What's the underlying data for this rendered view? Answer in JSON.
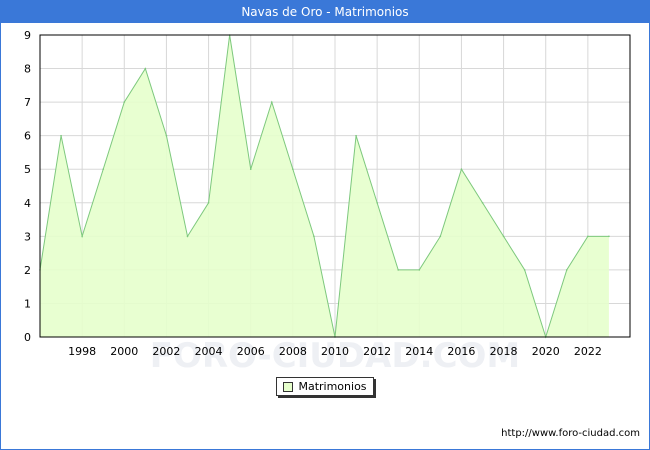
{
  "title": "Navas de Oro - Matrimonios",
  "source": "http://www.foro-ciudad.com",
  "watermark": "FORO-CIUDAD.COM",
  "chart_data": {
    "type": "area",
    "title": "Navas de Oro - Matrimonios",
    "xlabel": "",
    "ylabel": "",
    "x": [
      1996,
      1997,
      1998,
      1999,
      2000,
      2001,
      2002,
      2003,
      2004,
      2005,
      2006,
      2007,
      2008,
      2009,
      2010,
      2011,
      2012,
      2013,
      2014,
      2015,
      2016,
      2017,
      2018,
      2019,
      2020,
      2021,
      2022,
      2023
    ],
    "series": [
      {
        "name": "Matrimonios",
        "values": [
          2,
          6,
          3,
          5,
          7,
          8,
          6,
          3,
          4,
          9,
          5,
          7,
          5,
          3,
          0,
          6,
          4,
          2,
          2,
          3,
          5,
          4,
          3,
          2,
          0,
          2,
          3,
          3
        ]
      }
    ],
    "x_ticks": [
      "1998",
      "2000",
      "2002",
      "2004",
      "2006",
      "2008",
      "2010",
      "2012",
      "2014",
      "2016",
      "2018",
      "2020",
      "2022"
    ],
    "y_ticks": [
      "0",
      "1",
      "2",
      "3",
      "4",
      "5",
      "6",
      "7",
      "8",
      "9"
    ],
    "xlim": [
      1996,
      2024
    ],
    "ylim": [
      0,
      9
    ],
    "grid": true,
    "legend": "bottom-center",
    "colors": {
      "fill": "#e6ffcc",
      "line": "#7dc87d",
      "grid": "#d8d8d8",
      "title_bar": "#3a78d8"
    }
  }
}
